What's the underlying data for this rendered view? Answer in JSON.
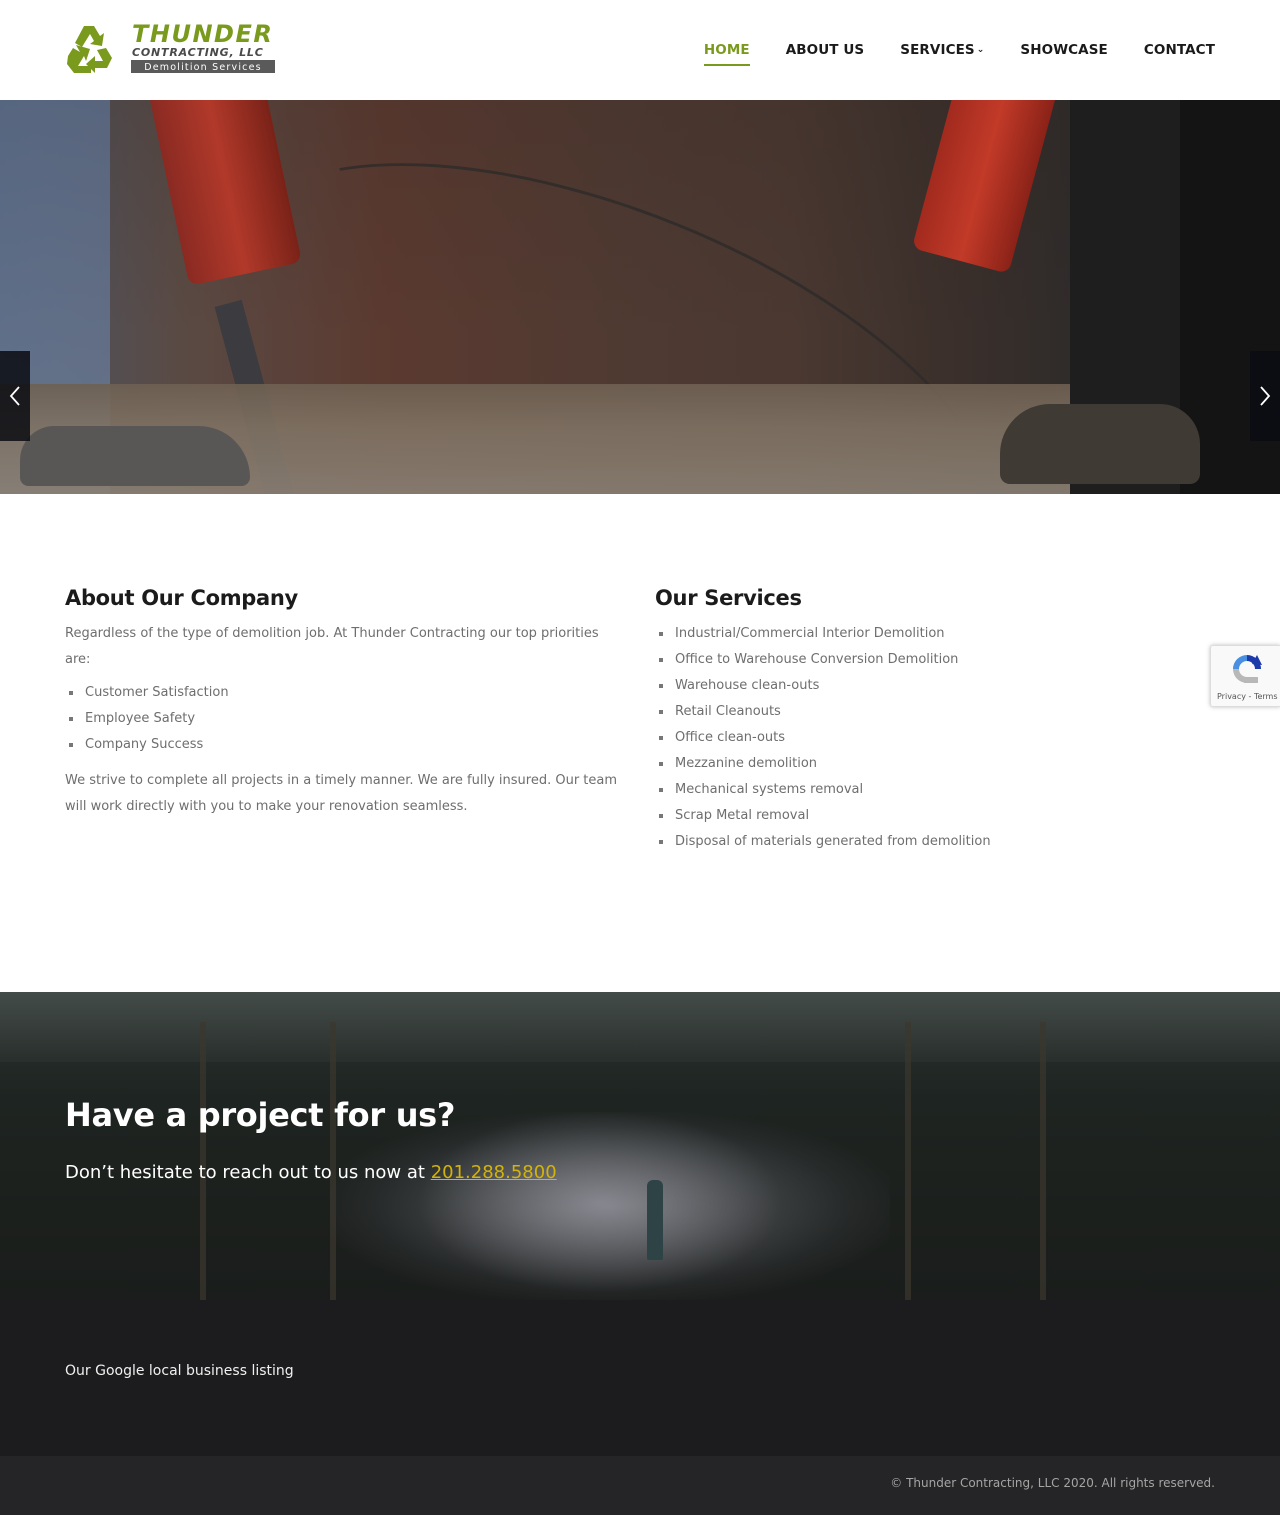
{
  "header": {
    "logo": {
      "title": "THUNDER",
      "subtitle": "CONTRACTING, LLC",
      "tagline": "Demolition Services",
      "icon": "recycle-icon",
      "brand_color": "#7a9a1e",
      "secondary_color": "#4a4a4a"
    },
    "nav": [
      {
        "label": "HOME",
        "active": true
      },
      {
        "label": "ABOUT US",
        "active": false
      },
      {
        "label": "SERVICES",
        "active": false,
        "has_dropdown": true,
        "dropdown_icon": "chevron-down-icon"
      },
      {
        "label": "SHOWCASE",
        "active": false
      },
      {
        "label": "CONTACT",
        "active": false
      }
    ]
  },
  "hero": {
    "prev_icon": "chevron-left-icon",
    "next_icon": "chevron-right-icon",
    "slides_count": 4,
    "active_slide": 1
  },
  "about": {
    "heading": "About Our Company",
    "intro": "Regardless of the type of demolition job. At Thunder Contracting our top priorities are:",
    "priorities": [
      "Customer Satisfaction",
      "Employee Safety",
      "Company Success"
    ],
    "closing": "We strive to complete all projects in a timely manner. We are fully insured. Our team will work directly with you to make your renovation seamless."
  },
  "services": {
    "heading": "Our Services",
    "items": [
      "Industrial/Commercial Interior Demolition",
      "Office to Warehouse Conversion Demolition",
      "Warehouse clean-outs",
      "Retail Cleanouts",
      "Office clean-outs",
      "Mezzanine demolition",
      "Mechanical systems removal",
      "Scrap Metal removal",
      "Disposal of materials generated from demolition"
    ]
  },
  "recaptcha": {
    "text": "Privacy - Terms"
  },
  "cta": {
    "heading": "Have a project for us?",
    "text": "Don’t hesitate to reach out to us now at ",
    "phone": "201.288.5800",
    "link_color": "#d4b30a"
  },
  "footer": {
    "listing": "Our Google local business listing",
    "copyright": "© Thunder Contracting, LLC 2020. All rights reserved."
  }
}
